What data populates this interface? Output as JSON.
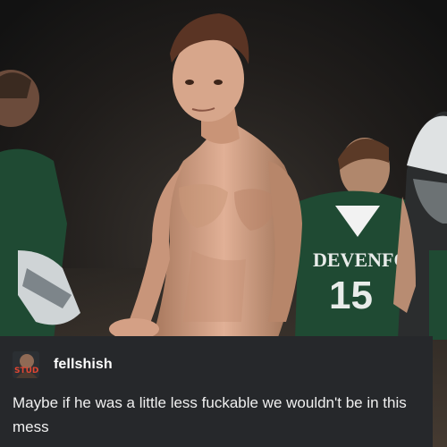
{
  "post": {
    "username": "fellshish",
    "text": "Maybe if he was a little less fuckable we wouldn't be in this mess"
  },
  "image": {
    "jersey_text": "DEVENFORD",
    "jersey_number": "15",
    "avatar_text": "STUD"
  },
  "colors": {
    "panel_bg": "#26282b",
    "text": "#f0f0f0",
    "jersey_green": "#1f4a33"
  }
}
